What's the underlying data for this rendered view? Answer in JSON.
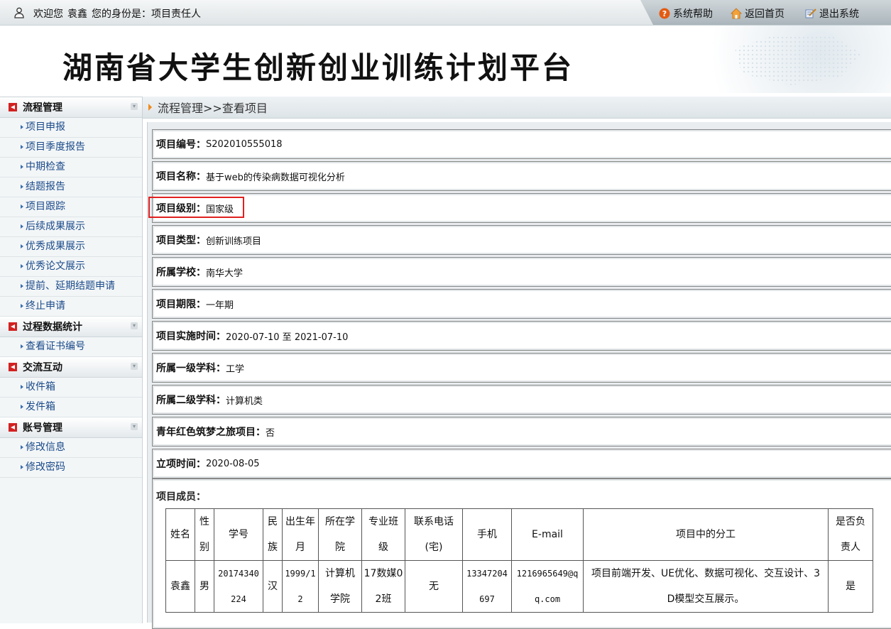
{
  "topbar": {
    "welcome": "欢迎您",
    "user_name": "袁鑫",
    "role_label": "您的身份是：项目责任人",
    "links": [
      {
        "label": "系统帮助",
        "icon": "help-icon"
      },
      {
        "label": "返回首页",
        "icon": "home-icon"
      },
      {
        "label": "退出系统",
        "icon": "logout-icon"
      }
    ]
  },
  "banner": {
    "title": "湖南省大学生创新创业训练计划平台"
  },
  "sidebar": {
    "sections": [
      {
        "title": "流程管理",
        "items": [
          "项目申报",
          "项目季度报告",
          "中期检查",
          "结题报告",
          "项目跟踪",
          "后续成果展示",
          "优秀成果展示",
          "优秀论文展示",
          "提前、延期结题申请",
          "终止申请"
        ]
      },
      {
        "title": "过程数据统计",
        "items": [
          "查看证书编号"
        ]
      },
      {
        "title": "交流互动",
        "items": [
          "收件箱",
          "发件箱"
        ]
      },
      {
        "title": "账号管理",
        "items": [
          "修改信息",
          "修改密码"
        ]
      }
    ]
  },
  "breadcrumb": "流程管理>>查看项目",
  "fields": [
    {
      "k": "项目编号：",
      "v": "S202010555018"
    },
    {
      "k": "项目名称：",
      "v": "基于web的传染病数据可视化分析"
    },
    {
      "k": "项目级别：",
      "v": "国家级"
    },
    {
      "k": "项目类型：",
      "v": "创新训练项目"
    },
    {
      "k": "所属学校：",
      "v": "南华大学"
    },
    {
      "k": "项目期限：",
      "v": "一年期"
    },
    {
      "k": "项目实施时间：",
      "v": "2020-07-10 至 2021-07-10"
    },
    {
      "k": "所属一级学科：",
      "v": "工学"
    },
    {
      "k": "所属二级学科：",
      "v": "计算机类"
    },
    {
      "k": "青年红色筑梦之旅项目：",
      "v": "否"
    },
    {
      "k": "立项时间：",
      "v": "2020-08-05"
    }
  ],
  "members": {
    "label": "项目成员：",
    "headers": [
      [
        "姓名"
      ],
      [
        "性",
        "别"
      ],
      [
        "学号"
      ],
      [
        "民",
        "族"
      ],
      [
        "出生年",
        "月"
      ],
      [
        "所在学",
        "院"
      ],
      [
        "专业班",
        "级"
      ],
      [
        "联系电话",
        "(宅)"
      ],
      [
        "手机"
      ],
      [
        "E-mail"
      ],
      [
        "项目中的分工"
      ],
      [
        "是否负",
        "责人"
      ]
    ],
    "rows": [
      [
        [
          "袁鑫"
        ],
        [
          "男"
        ],
        [
          "20174340",
          "224"
        ],
        [
          "汉"
        ],
        [
          "1999/1",
          "2"
        ],
        [
          "计算机",
          "学院"
        ],
        [
          "17数媒0",
          "2班"
        ],
        [
          "无"
        ],
        [
          "13347204",
          "697"
        ],
        [
          "1216965649@q",
          "q.com"
        ],
        [
          "项目前端开发、UE优化、数据可视化、交互设计、3",
          "D模型交互展示。"
        ],
        [
          "是"
        ]
      ]
    ]
  }
}
